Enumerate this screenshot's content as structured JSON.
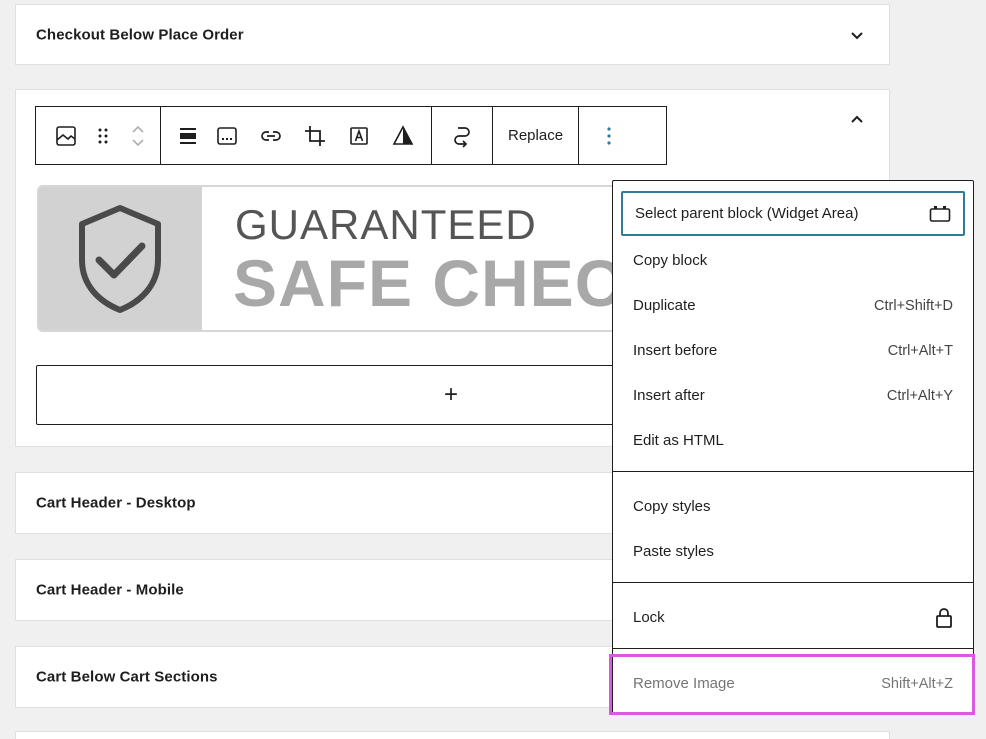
{
  "panels": {
    "checkout_below_place_order": "Checkout Below Place Order",
    "cart_header_desktop": "Cart Header - Desktop",
    "cart_header_mobile": "Cart Header - Mobile",
    "cart_below_cart_sections": "Cart Below Cart Sections"
  },
  "toolbar": {
    "replace_label": "Replace",
    "icons": [
      "image-icon",
      "drag-handle-icon",
      "move-up-down-icon",
      "align-icon",
      "caption-icon",
      "link-icon",
      "crop-icon",
      "text-overlay-icon",
      "duotone-icon",
      "transform-icon",
      "more-options-icon"
    ]
  },
  "image": {
    "line1": "GUARANTEED",
    "line2": "SAFE CHECKOUT",
    "icon": "shield-check-icon"
  },
  "appender": {
    "label": "+"
  },
  "menu": {
    "items": [
      {
        "label": "Select parent block (Widget Area)",
        "shortcut": "",
        "icon": "widget-area-icon"
      },
      {
        "label": "Copy block",
        "shortcut": ""
      },
      {
        "label": "Duplicate",
        "shortcut": "Ctrl+Shift+D"
      },
      {
        "label": "Insert before",
        "shortcut": "Ctrl+Alt+T"
      },
      {
        "label": "Insert after",
        "shortcut": "Ctrl+Alt+Y"
      },
      {
        "label": "Edit as HTML",
        "shortcut": ""
      },
      {
        "label": "Copy styles",
        "shortcut": ""
      },
      {
        "label": "Paste styles",
        "shortcut": ""
      },
      {
        "label": "Lock",
        "shortcut": "",
        "icon": "lock-icon"
      },
      {
        "label": "Remove Image",
        "shortcut": "Shift+Alt+Z"
      }
    ]
  },
  "colors": {
    "focus": "#2f7d95",
    "highlight": "#d65be0",
    "background": "#f0f0f0"
  }
}
